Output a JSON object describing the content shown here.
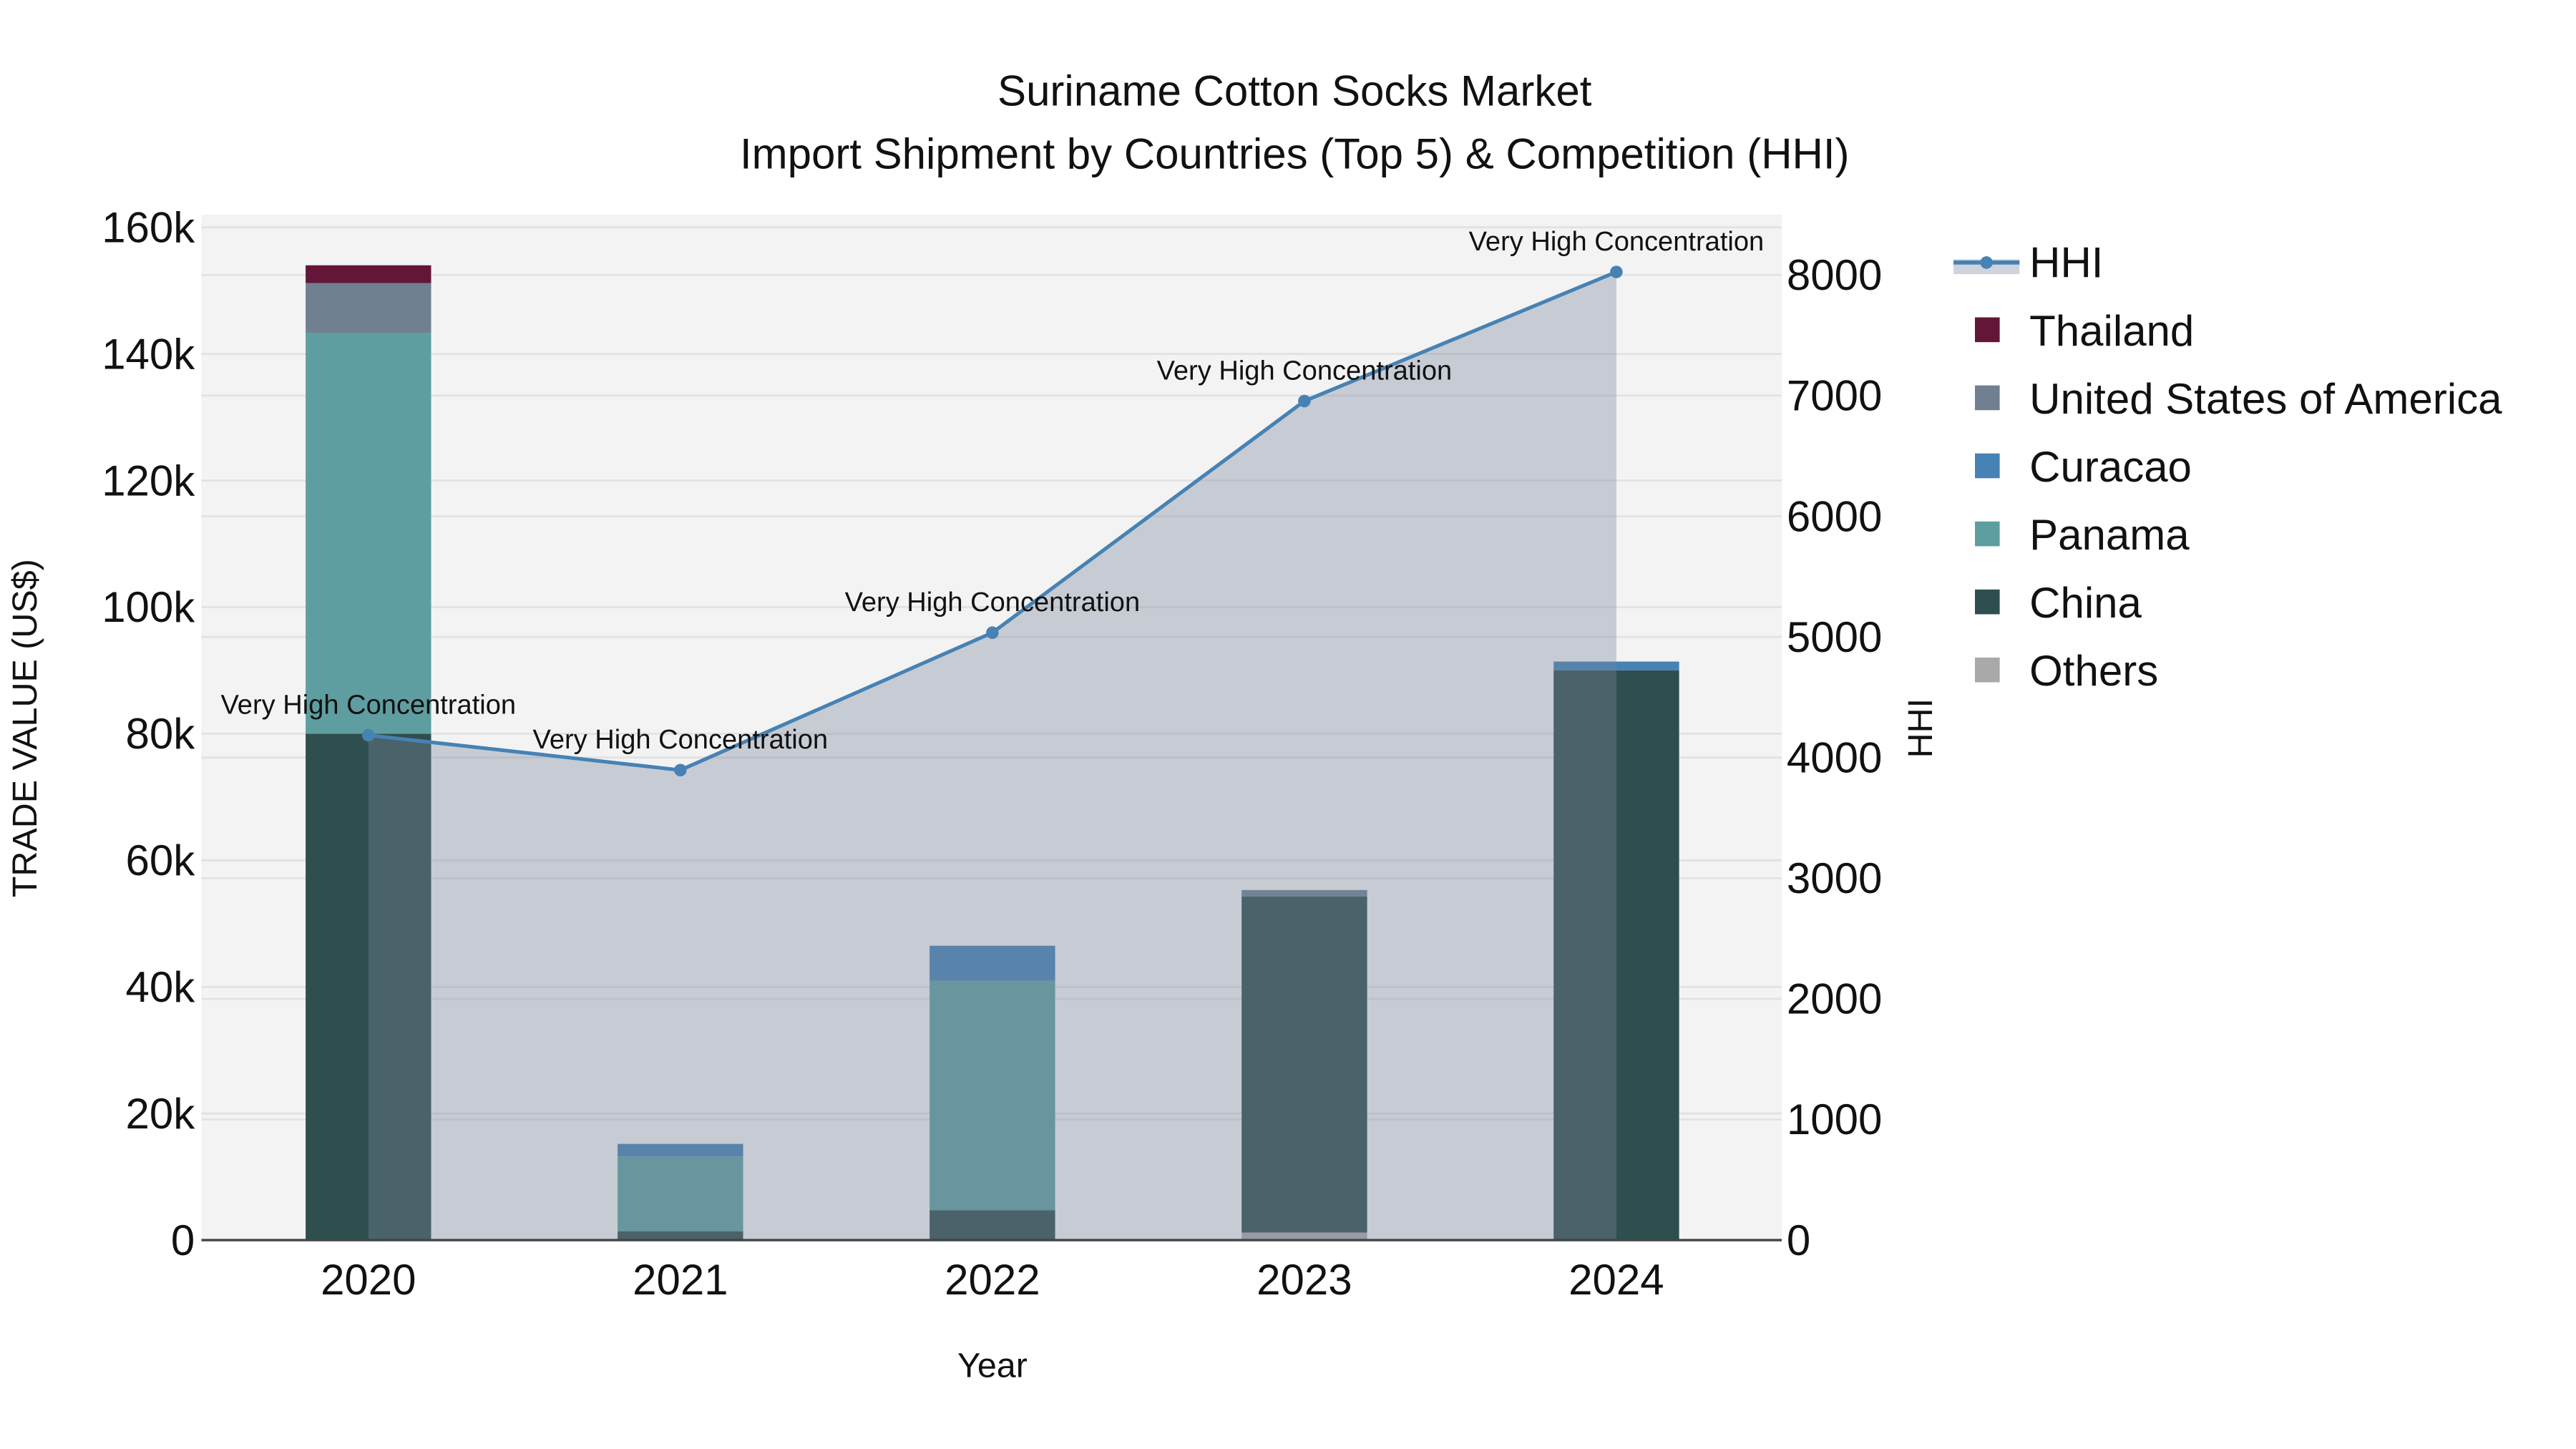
{
  "chart_data": {
    "type": "bar",
    "title": "Suriname Cotton Socks Market",
    "subtitle": "Import Shipment by Countries (Top 5) & Competition (HHI)",
    "xlabel": "Year",
    "ylabel": "TRADE VALUE (US$)",
    "y2label": "HHI",
    "categories": [
      "2020",
      "2021",
      "2022",
      "2023",
      "2024"
    ],
    "ylim": [
      0,
      162000
    ],
    "y2lim": [
      0,
      8500
    ],
    "yticks": [
      0,
      20000,
      40000,
      60000,
      80000,
      100000,
      120000,
      140000,
      160000
    ],
    "ytick_labels": [
      "0",
      "20k",
      "40k",
      "60k",
      "80k",
      "100k",
      "120k",
      "140k",
      "160k"
    ],
    "y2ticks": [
      0,
      1000,
      2000,
      3000,
      4000,
      5000,
      6000,
      7000,
      8000
    ],
    "y2tick_labels": [
      "0",
      "1000",
      "2000",
      "3000",
      "4000",
      "5000",
      "6000",
      "7000",
      "8000"
    ],
    "grid": true,
    "legend_position": "right",
    "series": [
      {
        "name": "Others",
        "color": "#A9A9A9",
        "values": [
          0,
          0,
          0,
          1200,
          0
        ]
      },
      {
        "name": "China",
        "color": "#2F4F4F",
        "values": [
          80000,
          1400,
          4700,
          53100,
          90000
        ]
      },
      {
        "name": "Panama",
        "color": "#5F9EA0",
        "values": [
          63300,
          11800,
          36300,
          0,
          0
        ]
      },
      {
        "name": "Curacao",
        "color": "#4682B4",
        "values": [
          0,
          2000,
          5500,
          0,
          1400
        ]
      },
      {
        "name": "United States of America",
        "color": "#708090",
        "values": [
          7900,
          0,
          0,
          1000,
          0
        ]
      },
      {
        "name": "Thailand",
        "color": "#641638",
        "values": [
          2800,
          0,
          0,
          0,
          0
        ]
      }
    ],
    "hhi": {
      "name": "HHI",
      "color": "#4682B4",
      "values": [
        4185,
        3896,
        5035,
        6955,
        8025
      ],
      "labels": [
        "Very High Concentration",
        "Very High Concentration",
        "Very High Concentration",
        "Very High Concentration",
        "Very High Concentration"
      ]
    },
    "legend_order": [
      "HHI",
      "Thailand",
      "United States of America",
      "Curacao",
      "Panama",
      "China",
      "Others"
    ]
  }
}
